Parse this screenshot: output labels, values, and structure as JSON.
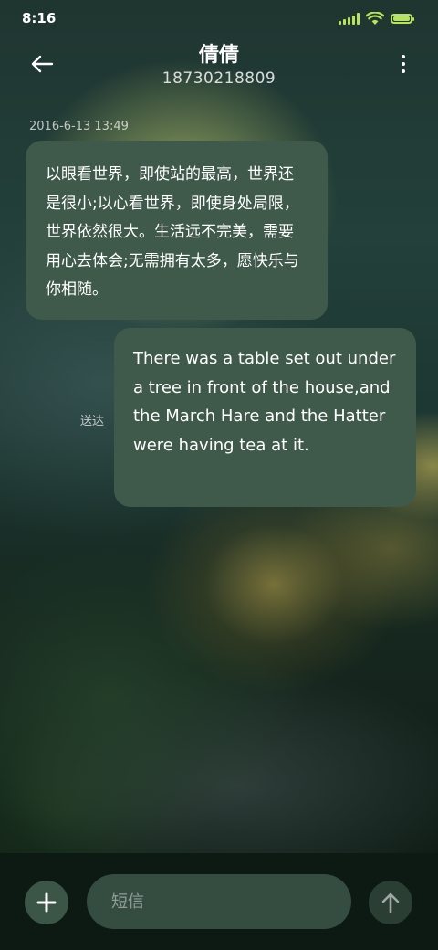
{
  "status_bar": {
    "time": "8:16",
    "accent_color": "#b7e35f"
  },
  "header": {
    "contact_name": "倩倩",
    "contact_number": "18730218809",
    "back_icon": "back-arrow-icon",
    "more_icon": "more-vertical-icon"
  },
  "conversation": {
    "timestamp": "2016-6-13 13:49",
    "messages": [
      {
        "direction": "incoming",
        "text": "以眼看世界，即使站的最高，世界还是很小;以心看世界，即使身处局限，世界依然很大。生活远不完美，需要用心去体会;无需拥有太多，愿快乐与你相随。"
      },
      {
        "direction": "outgoing",
        "text": "There was a table set out under a tree in front of the house,and the March Hare and the Hatter were having tea at it.",
        "status": "送达"
      }
    ],
    "bubble_color": "#3f5a4a"
  },
  "composer": {
    "input_placeholder": "短信",
    "input_value": "",
    "add_icon": "plus-icon",
    "send_icon": "send-arrow-icon"
  }
}
